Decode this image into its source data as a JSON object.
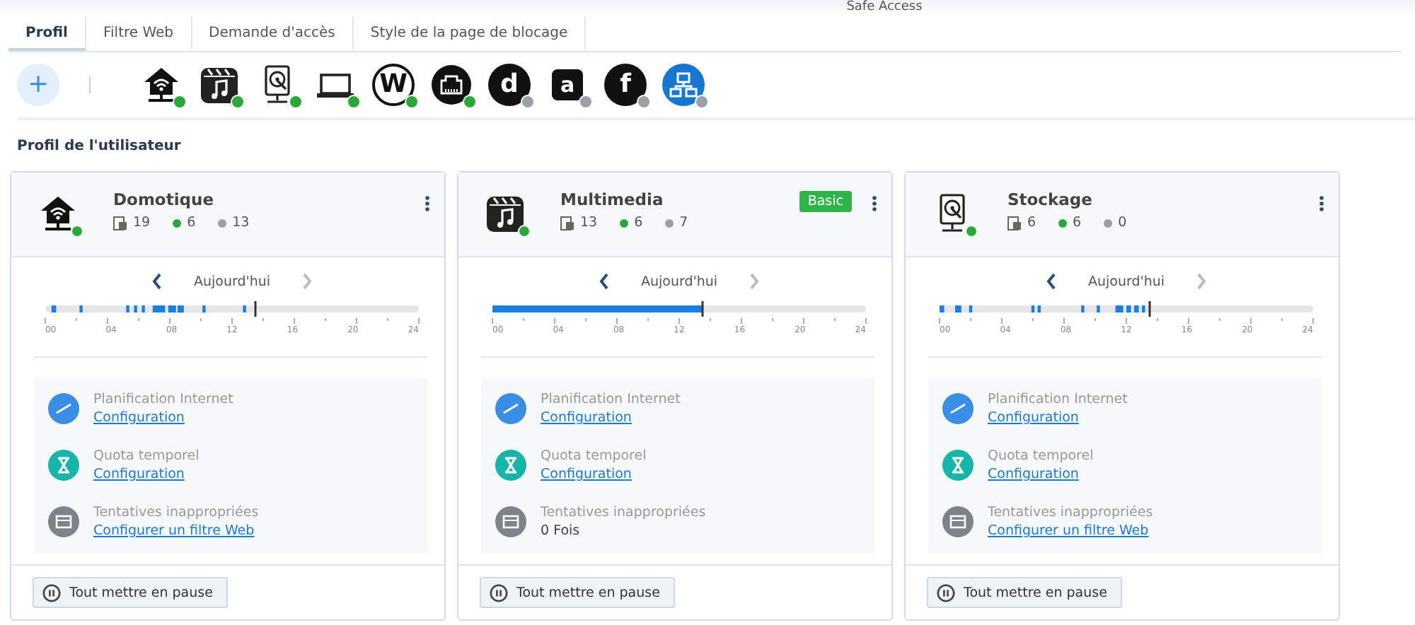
{
  "window": {
    "title": "Safe Access"
  },
  "tabs": [
    {
      "label": "Profil",
      "selected": true
    },
    {
      "label": "Filtre Web",
      "selected": false
    },
    {
      "label": "Demande d'accès",
      "selected": false
    },
    {
      "label": "Style de la page de blocage",
      "selected": false
    }
  ],
  "toolbar": {
    "add_button": "+",
    "profiles": [
      {
        "kind": "house",
        "online": true
      },
      {
        "kind": "clapper",
        "online": true
      },
      {
        "kind": "drive",
        "online": true
      },
      {
        "kind": "laptop",
        "online": true
      },
      {
        "kind": "ring-letter",
        "glyph": "W",
        "online": true
      },
      {
        "kind": "router",
        "online": true
      },
      {
        "kind": "disc-letter",
        "glyph": "d",
        "online": false
      },
      {
        "kind": "square-letter",
        "glyph": "a",
        "online": false
      },
      {
        "kind": "disc-letter",
        "glyph": "f",
        "online": false
      },
      {
        "kind": "network",
        "online": false
      }
    ]
  },
  "section_title": "Profil de l'utilisateur",
  "cards": [
    {
      "kind": "house",
      "online": true,
      "name": "Domotique",
      "devices": "19",
      "online_count": "6",
      "offline_count": "13",
      "timeline": {
        "label": "Aujourd'hui",
        "next_disabled": true,
        "hours": [
          "00",
          "04",
          "08",
          "12",
          "16",
          "20",
          "24"
        ]
      },
      "rules": [
        {
          "kind": "schedule",
          "title": "Planification Internet",
          "link": "Configuration"
        },
        {
          "kind": "quota",
          "title": "Quota temporel",
          "link": "Configuration"
        },
        {
          "kind": "attempts",
          "title": "Tentatives inappropriées",
          "link": "Configurer un filtre Web"
        }
      ],
      "pause_button": "Tout mettre en pause"
    },
    {
      "kind": "clapper",
      "online": true,
      "name": "Multimedia",
      "badge": "Basic",
      "devices": "13",
      "online_count": "6",
      "offline_count": "7",
      "timeline": {
        "label": "Aujourd'hui",
        "next_disabled": true,
        "hours": [
          "00",
          "04",
          "08",
          "12",
          "16",
          "20",
          "24"
        ]
      },
      "rules": [
        {
          "kind": "schedule",
          "title": "Planification Internet",
          "link": "Configuration"
        },
        {
          "kind": "quota",
          "title": "Quota temporel",
          "link": "Configuration"
        },
        {
          "kind": "attempts",
          "title": "Tentatives inappropriées",
          "value": "0 Fois"
        }
      ],
      "pause_button": "Tout mettre en pause"
    },
    {
      "kind": "drive",
      "online": true,
      "name": "Stockage",
      "devices": "6",
      "online_count": "6",
      "offline_count": "0",
      "timeline": {
        "label": "Aujourd'hui",
        "next_disabled": true,
        "hours": [
          "00",
          "04",
          "08",
          "12",
          "16",
          "20",
          "24"
        ]
      },
      "rules": [
        {
          "kind": "schedule",
          "title": "Planification Internet",
          "link": "Configuration"
        },
        {
          "kind": "quota",
          "title": "Quota temporel",
          "link": "Configuration"
        },
        {
          "kind": "attempts",
          "title": "Tentatives inappropriées",
          "link": "Configurer un filtre Web"
        }
      ],
      "pause_button": "Tout mettre en pause"
    }
  ]
}
